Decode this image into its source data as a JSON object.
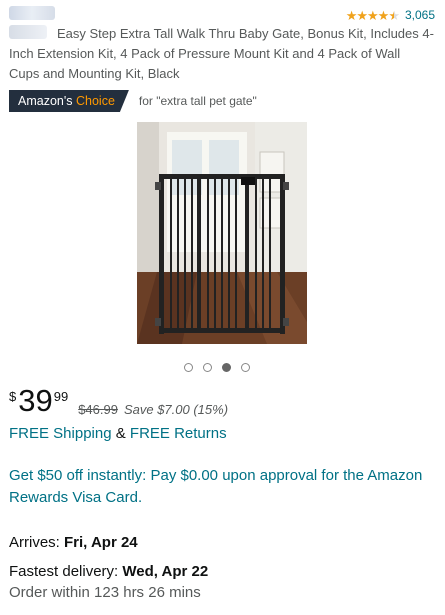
{
  "product": {
    "title": "Easy Step Extra Tall Walk Thru Baby Gate, Bonus Kit, Includes 4-Inch Extension Kit, 4 Pack of Pressure Mount Kit and 4 Pack of Wall Cups and Mounting Kit, Black",
    "rating_stars": 4.5,
    "review_count": "3,065"
  },
  "badge": {
    "prefix": "Amazon's",
    "choice": "Choice",
    "for_text": "for \"extra tall pet gate\""
  },
  "carousel": {
    "total": 4,
    "active_index": 2
  },
  "price": {
    "symbol": "$",
    "whole": "39",
    "fraction": "99",
    "list_price": "$46.99",
    "savings": "Save $7.00 (15%)"
  },
  "shipping": {
    "free_shipping": "FREE Shipping",
    "ampersand": "&",
    "free_returns": "FREE Returns"
  },
  "promo": {
    "text": "Get $50 off instantly: Pay $0.00 upon approval for the Amazon Rewards Visa Card."
  },
  "delivery": {
    "arrives_label": "Arrives:",
    "arrives_date": "Fri, Apr 24",
    "fastest_label": "Fastest delivery:",
    "fastest_date": "Wed, Apr 22",
    "order_within": "Order within 123 hrs 26 mins"
  },
  "colors": {
    "link": "#007185",
    "star": "#f0a21c",
    "badge_bg": "#232f3e",
    "badge_accent": "#ff9900"
  }
}
